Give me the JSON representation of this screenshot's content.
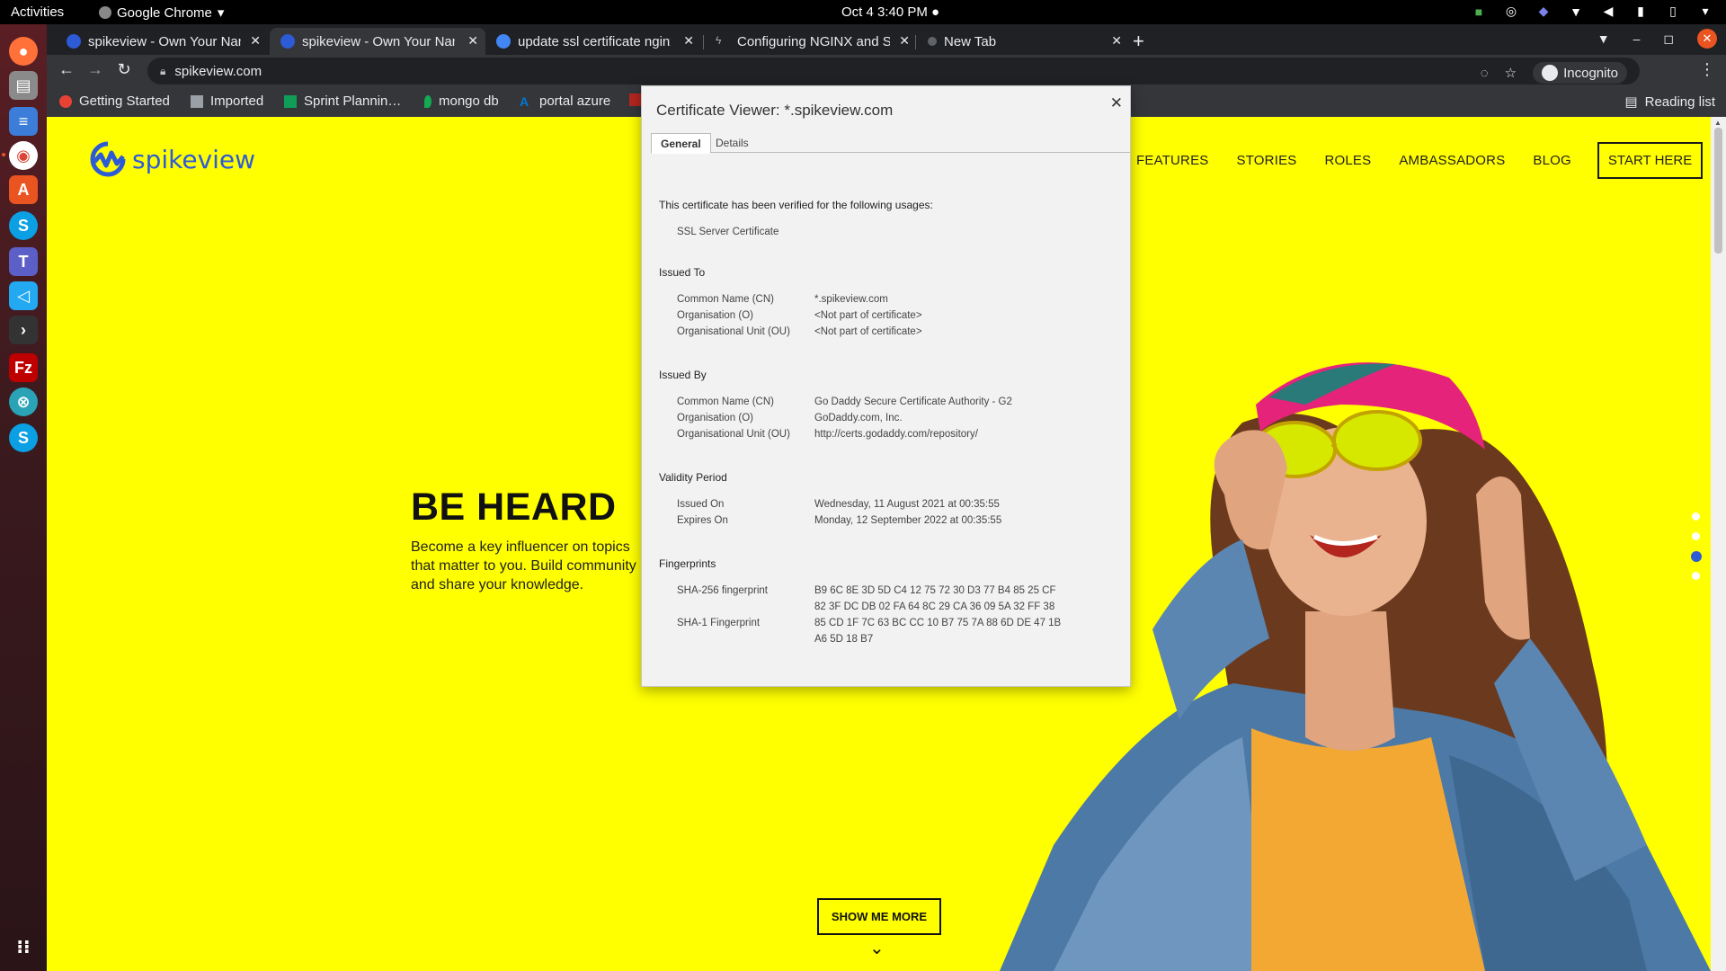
{
  "os": {
    "activities": "Activities",
    "app_name": "Google Chrome",
    "clock": "Oct 4  3:40 PM"
  },
  "tabs": [
    {
      "title": "spikeview - Own Your Name",
      "active": false
    },
    {
      "title": "spikeview - Own Your Name",
      "active": true
    },
    {
      "title": "update ssl certificate nginx",
      "active": false
    },
    {
      "title": "Configuring NGINX and SSL",
      "active": false
    },
    {
      "title": "New Tab",
      "active": false
    }
  ],
  "address": {
    "url": "spikeview.com",
    "incognito_label": "Incognito"
  },
  "bookmarks": [
    {
      "label": "Getting Started",
      "color": "#e94235"
    },
    {
      "label": "Imported",
      "color": "#9aa0a6"
    },
    {
      "label": "Sprint Plannin…",
      "color": "#0f9d58"
    },
    {
      "label": "mongo db",
      "color": "#13aa52"
    },
    {
      "label": "portal azure",
      "color": "#0078d4"
    }
  ],
  "reading_list": "Reading list",
  "site": {
    "brand": "spikeview",
    "nav": [
      "FEATURES",
      "STORIES",
      "ROLES",
      "AMBASSADORS",
      "BLOG"
    ],
    "cta": "START HERE",
    "hero_title": "BE HEARD",
    "hero_body": "Become a key influencer on topics that matter to you. Build community and share your knowledge.",
    "show_more": "SHOW ME MORE",
    "accent": "#ffff00",
    "brand_color": "#2d5bd6"
  },
  "cert": {
    "title": "Certificate Viewer: *.spikeview.com",
    "tab_general": "General",
    "tab_details": "Details",
    "verified_text": "This certificate has been verified for the following usages:",
    "usage": "SSL Server Certificate",
    "issued_to_heading": "Issued To",
    "issued_to": [
      {
        "label": "Common Name (CN)",
        "value": "*.spikeview.com"
      },
      {
        "label": "Organisation (O)",
        "value": "<Not part of certificate>"
      },
      {
        "label": "Organisational Unit (OU)",
        "value": "<Not part of certificate>"
      }
    ],
    "issued_by_heading": "Issued By",
    "issued_by": [
      {
        "label": "Common Name (CN)",
        "value": "Go Daddy Secure Certificate Authority - G2"
      },
      {
        "label": "Organisation (O)",
        "value": "GoDaddy.com, Inc."
      },
      {
        "label": "Organisational Unit (OU)",
        "value": "http://certs.godaddy.com/repository/"
      }
    ],
    "validity_heading": "Validity Period",
    "validity": [
      {
        "label": "Issued On",
        "value": "Wednesday, 11 August 2021 at 00:35:55"
      },
      {
        "label": "Expires On",
        "value": "Monday, 12 September 2022 at 00:35:55"
      }
    ],
    "fingerprints_heading": "Fingerprints",
    "fingerprints": [
      {
        "label": "SHA-256 fingerprint",
        "line1": "B9 6C 8E 3D 5D C4 12 75 72 30 D3 77 B4 85 25 CF",
        "line2": "82 3F DC DB 02 FA 64 8C 29 CA 36 09 5A 32 FF 38"
      },
      {
        "label": "SHA-1 Fingerprint",
        "line1": "85 CD 1F 7C 63 BC CC 10 B7 75 7A 88 6D DE 47 1B",
        "line2": "A6 5D 18 B7"
      }
    ]
  }
}
